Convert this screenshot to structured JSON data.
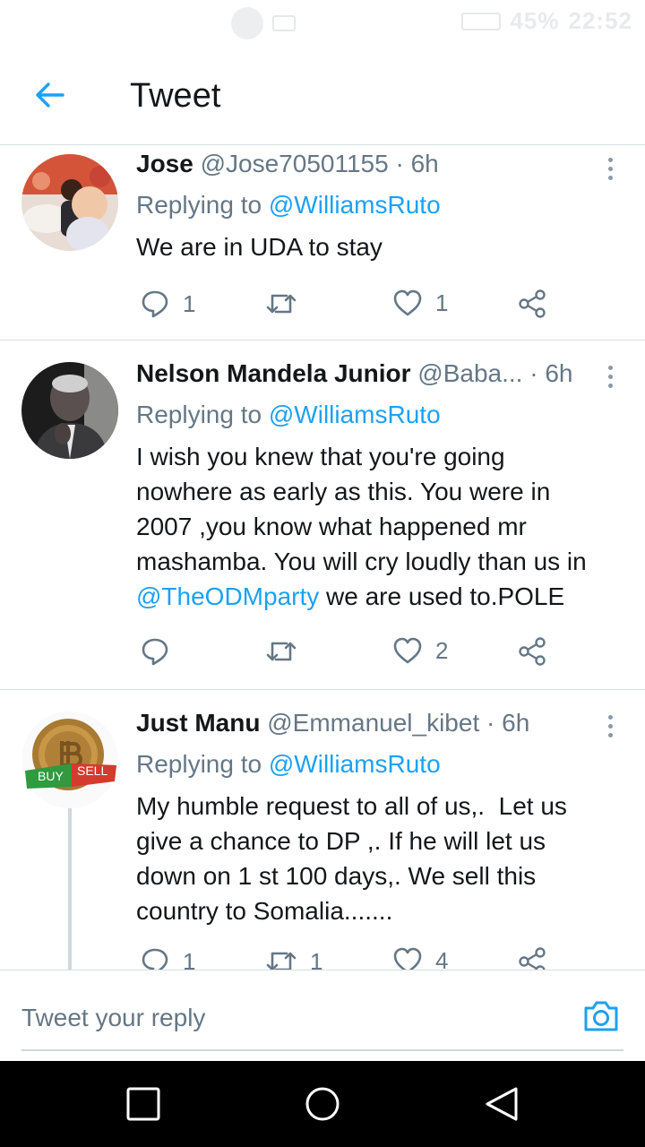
{
  "status_bar": {
    "battery": "45%",
    "time": "22:52"
  },
  "header": {
    "title": "Tweet"
  },
  "tweets": [
    {
      "name": "Jose",
      "handle": "@Jose70501155",
      "sep": "·",
      "time": "6h",
      "replying_prefix": "Replying to",
      "replying_to": "@WilliamsRuto",
      "text": "We are in UDA to stay",
      "reply_count": "1",
      "retweet_count": "",
      "like_count": "1"
    },
    {
      "name": "Nelson Mandela Junior",
      "handle": "@Baba...",
      "sep": "·",
      "time": "6h",
      "replying_prefix": "Replying to",
      "replying_to": "@WilliamsRuto",
      "text_lines": [
        "I wish you knew that you're going",
        "nowhere as early as this. You were in",
        "2007 ,you know what happened mr",
        "mashamba. You will cry loudly than us in"
      ],
      "text_mention": "@TheODMparty",
      "text_tail": " we are used to.POLE",
      "reply_count": "",
      "retweet_count": "",
      "like_count": "2"
    },
    {
      "name": "Just Manu",
      "handle": "@Emmanuel_kibet",
      "sep": "·",
      "time": "6h",
      "replying_prefix": "Replying to",
      "replying_to": "@WilliamsRuto",
      "avatar_badge": {
        "buy": "BUY",
        "sell": "SELL"
      },
      "text_lines": [
        "My humble request to all of us,.  Let us",
        "give a chance to DP ,. If he will let us",
        "down on 1 st 100 days,. We sell this",
        "country to Somalia......."
      ],
      "reply_count": "1",
      "retweet_count": "1",
      "like_count": "4"
    }
  ],
  "reply_bar": {
    "placeholder": "Tweet your reply"
  },
  "colors": {
    "accent": "#1da1f2",
    "secondary_text": "#657786",
    "divider": "#d8dee2"
  },
  "icons": {
    "back": "arrow-left-icon",
    "more": "more-vertical-icon",
    "reply": "speech-bubble-icon",
    "retweet": "retweet-icon",
    "like": "heart-icon",
    "share": "share-icon",
    "camera": "camera-icon"
  }
}
